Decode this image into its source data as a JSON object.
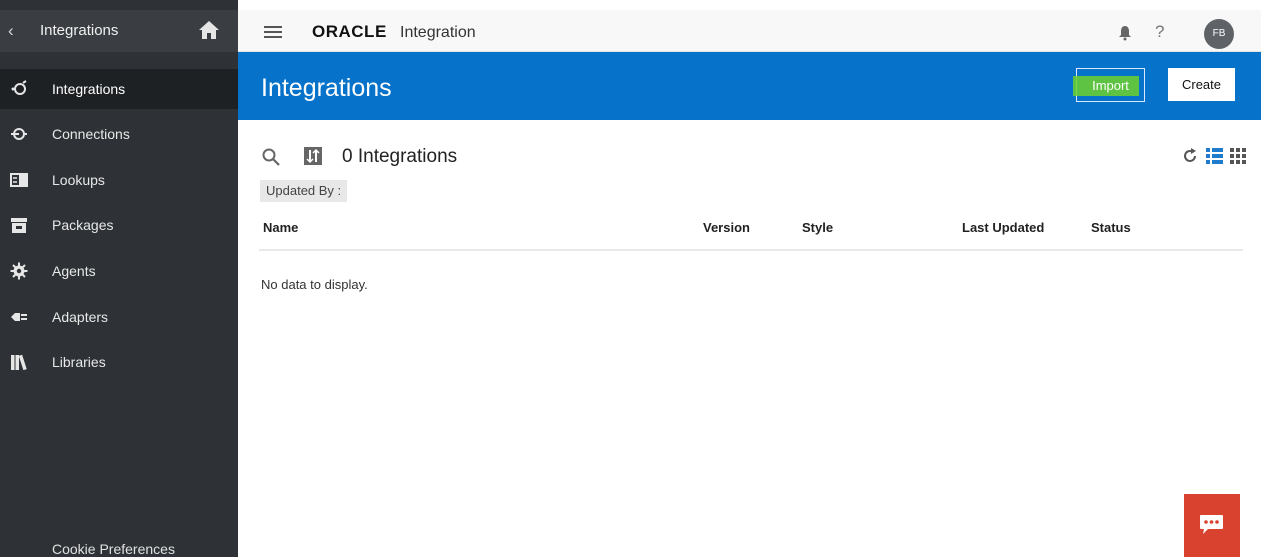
{
  "sidebar": {
    "title": "Integrations",
    "items": [
      {
        "label": "Integrations",
        "icon": "integrations-icon",
        "active": true
      },
      {
        "label": "Connections",
        "icon": "connections-icon"
      },
      {
        "label": "Lookups",
        "icon": "lookups-icon"
      },
      {
        "label": "Packages",
        "icon": "packages-icon"
      },
      {
        "label": "Agents",
        "icon": "gear-icon"
      },
      {
        "label": "Adapters",
        "icon": "plug-icon"
      },
      {
        "label": "Libraries",
        "icon": "books-icon"
      }
    ],
    "cookie_label": "Cookie Preferences"
  },
  "topbar": {
    "brand": "ORACLE",
    "brand_sub": "Integration",
    "help_glyph": "?",
    "avatar_initials": "FB"
  },
  "header": {
    "title": "Integrations",
    "import_label": "Import",
    "create_label": "Create",
    "accent": "#0672c9"
  },
  "main": {
    "count_label": "0 Integrations",
    "filter_label": "Updated By :",
    "columns": [
      "Name",
      "Version",
      "Style",
      "Last Updated",
      "Status"
    ],
    "empty_text": "No data to display."
  },
  "colors": {
    "sidebar_bg": "#2e3236",
    "chat_bg": "#d9422e",
    "highlight": "#6fd12a"
  }
}
